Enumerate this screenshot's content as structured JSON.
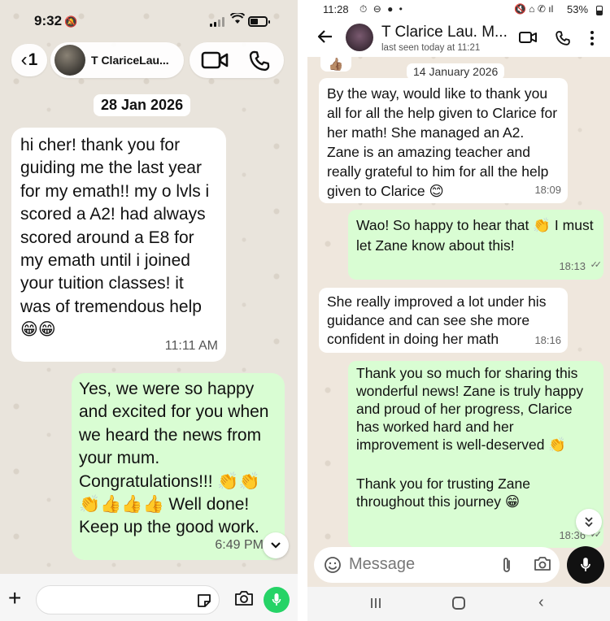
{
  "left_chat": {
    "status_bar": {
      "time": "9:32"
    },
    "header": {
      "back_count": "1",
      "contact_name": "T ClariceLau..."
    },
    "date_chip": "28 Jan 2026",
    "incoming_message": {
      "text": "hi cher! thank you for guiding me the last year for my emath!! my o lvls i scored a A2! had always scored around a E8 for my emath until i joined your tuition classes! it was of tremendous help 😁😁",
      "time": "11:11 AM"
    },
    "outgoing_message": {
      "text": "Yes, we were so happy and excited for you when we heard the news from your mum. Congratulations!!! 👏👏👏👍👍👍 Well done! Keep up the good work.",
      "time": "6:49 PM"
    },
    "icons": {
      "plus": "plus-icon",
      "sticker": "sticker-icon",
      "camera": "camera-icon",
      "mic": "microphone-icon"
    },
    "colors": {
      "background": "#e9e4dc",
      "outgoing_bubble": "#d9fdd3",
      "mic_button": "#25d366"
    }
  },
  "right_chat": {
    "status_bar": {
      "time": "11:28",
      "battery": "53%"
    },
    "header": {
      "contact_name": "T Clarice Lau. M...",
      "last_seen": "last seen today at 11:21"
    },
    "peek_emoji": "👍🏽",
    "date_chip": "14 January 2026",
    "messages": [
      {
        "direction": "in",
        "text": "By the way, would like to thank you all for all the help given to Clarice for her math! She managed an A2. Zane is an amazing teacher and really grateful to him for all the help given to Clarice 😊",
        "time": "18:09"
      },
      {
        "direction": "out",
        "text": "Wao! So happy to hear that 👏 I must let Zane know about this!",
        "time": "18:13"
      },
      {
        "direction": "in",
        "text": "She really improved a lot under his guidance and can see she more confident in doing her math",
        "time": "18:16"
      },
      {
        "direction": "out",
        "text_part1": "Thank you so much for sharing this wonderful news! Zane is truly happy and proud of her progress, Clarice has worked hard and her improvement is well-deserved 👏",
        "text_part2": "Thank you for trusting Zane throughout this journey 😁",
        "time": "18:36"
      }
    ],
    "input": {
      "placeholder": "Message"
    },
    "colors": {
      "background": "#efe7dd",
      "outgoing_bubble": "#d9fdd3",
      "mic_button": "#111111"
    }
  }
}
